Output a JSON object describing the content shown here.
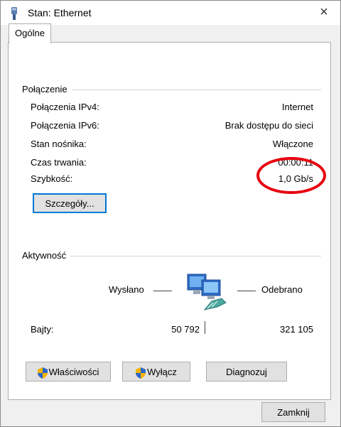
{
  "window": {
    "title": "Stan: Ethernet",
    "close_label": "×"
  },
  "tabs": [
    {
      "label": "Ogólne"
    }
  ],
  "connection": {
    "group_label": "Połączenie",
    "rows": [
      {
        "label": "Połączenia IPv4:",
        "value": "Internet"
      },
      {
        "label": "Połączenia IPv6:",
        "value": "Brak dostępu do sieci"
      },
      {
        "label": "Stan nośnika:",
        "value": "Włączone"
      },
      {
        "label": "Czas trwania:",
        "value": "00:00:11"
      },
      {
        "label": "Szybkość:",
        "value": "1,0 Gb/s"
      }
    ],
    "details_button": "Szczegóły..."
  },
  "activity": {
    "group_label": "Aktywność",
    "sent_label": "Wysłano",
    "received_label": "Odebrano",
    "bytes_label": "Bajty:",
    "bytes_sent": "50 792",
    "bytes_received": "321 105"
  },
  "buttons": {
    "properties": "Właściwości",
    "disable": "Wyłącz",
    "diagnose": "Diagnozuj"
  },
  "footer": {
    "close_button": "Zamknij"
  },
  "colors": {
    "accent": "#0078d7",
    "annotation": "#e8000f"
  }
}
